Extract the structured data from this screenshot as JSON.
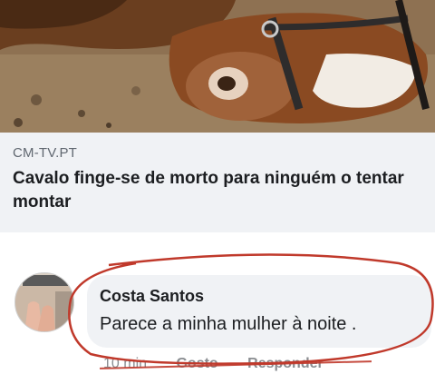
{
  "post": {
    "image_icon": "horse-photo",
    "link_domain": "CM-TV.PT",
    "headline": "Cavalo finge-se de morto para ninguém o tentar montar"
  },
  "comment": {
    "avatar_icon": "profile-avatar",
    "author": "Costa Santos",
    "text": "Parece a minha mulher à noite .",
    "time": "10 min",
    "like_label": "Gosto",
    "reply_label": "Responder"
  },
  "colors": {
    "annotation": "#c0392b",
    "preview_bg": "#f0f2f5",
    "text_primary": "#1c1e21",
    "text_secondary": "#606770"
  }
}
